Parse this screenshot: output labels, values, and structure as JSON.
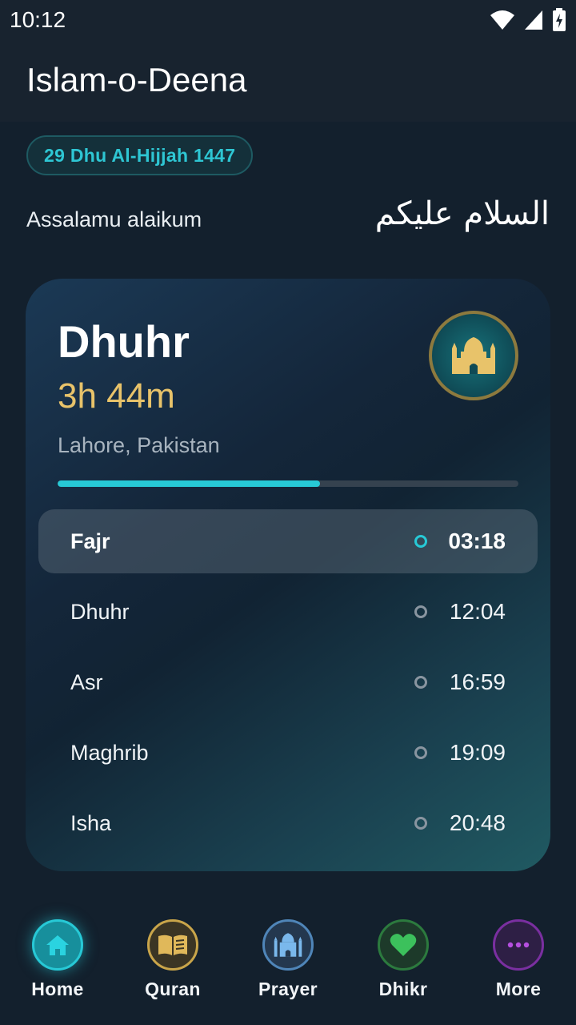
{
  "status_bar": {
    "time": "10:12"
  },
  "app": {
    "title": "Islam-o-Deena"
  },
  "hijri_date": "29 Dhu Al-Hijjah 1447",
  "greeting": {
    "english": "Assalamu alaikum",
    "arabic": "السلام عليكم"
  },
  "next_prayer": {
    "name": "Dhuhr",
    "countdown": "3h 44m",
    "location": "Lahore, Pakistan",
    "progress_fraction": 0.57
  },
  "prayers": [
    {
      "name": "Fajr",
      "time": "03:18",
      "active": true
    },
    {
      "name": "Dhuhr",
      "time": "12:04",
      "active": false
    },
    {
      "name": "Asr",
      "time": "16:59",
      "active": false
    },
    {
      "name": "Maghrib",
      "time": "19:09",
      "active": false
    },
    {
      "name": "Isha",
      "time": "20:48",
      "active": false
    }
  ],
  "nav": [
    {
      "label": "Home",
      "icon": "home-icon",
      "color": "#27c9d6"
    },
    {
      "label": "Quran",
      "icon": "book-icon",
      "color": "#c9a54a"
    },
    {
      "label": "Prayer",
      "icon": "mosque-icon",
      "color": "#5d9fd8"
    },
    {
      "label": "Dhikr",
      "icon": "heart-icon",
      "color": "#2fa54c"
    },
    {
      "label": "More",
      "icon": "more-icon",
      "color": "#9b3fc4"
    }
  ],
  "colors": {
    "accent": "#27c9d6",
    "gold": "#e8c36a",
    "background": "#13202d"
  }
}
